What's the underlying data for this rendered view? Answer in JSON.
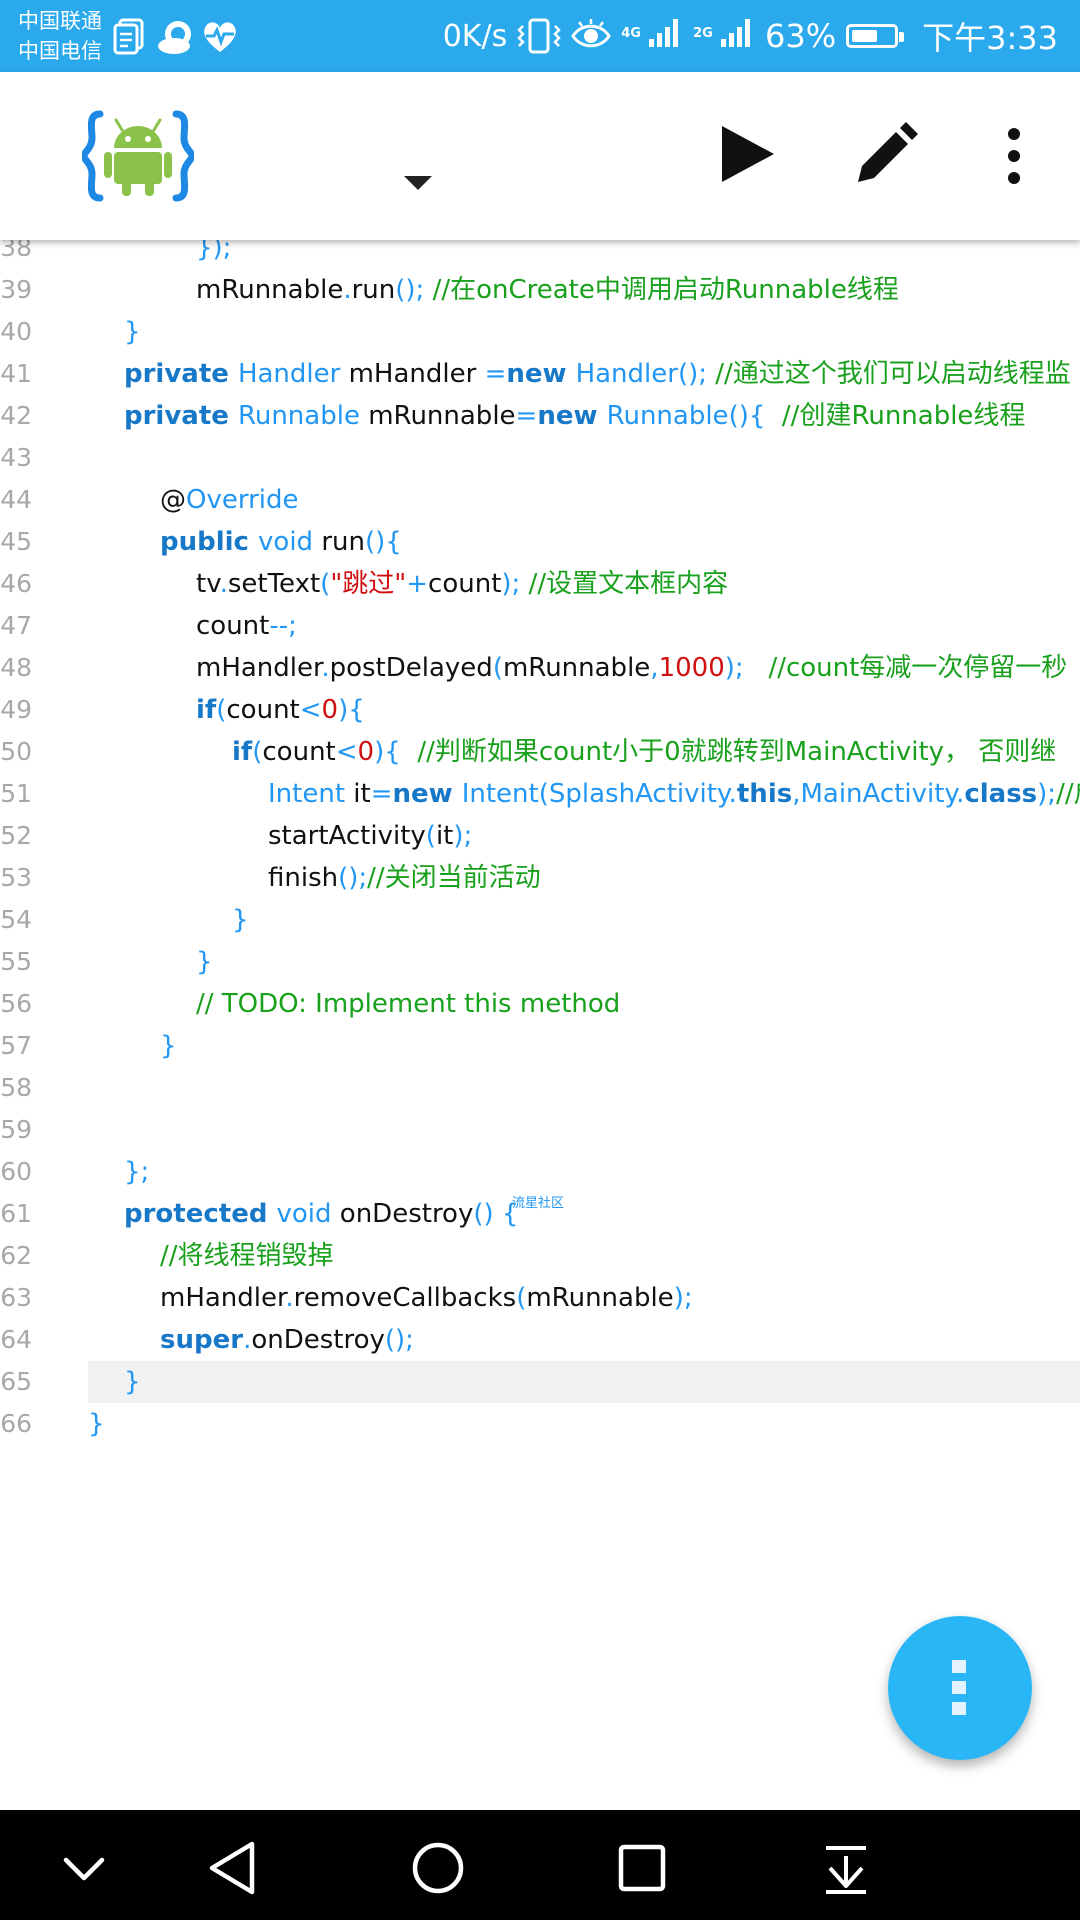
{
  "status_bar": {
    "carrier_1": "中国联通",
    "carrier_2": "中国电信",
    "net_speed": "0K/s",
    "net_type_1": "4G",
    "net_type_2": "2G",
    "battery_percent": "63%",
    "battery_level": 0.63,
    "time": "下午3:33",
    "icons": [
      "document-icon",
      "cloud-icon",
      "heart-pulse-icon",
      "vibrate-icon",
      "eye-icon",
      "signal-icon",
      "battery-icon"
    ]
  },
  "toolbar": {
    "logo_icon": "android-logo-icon",
    "dropdown_icon": "dropdown-triangle-icon",
    "run_icon": "play-icon",
    "edit_icon": "pencil-icon",
    "menu_icon": "more-vert-icon"
  },
  "colors": {
    "status_bar": "#2aa9ec",
    "keyword": "#1878c8",
    "type": "#2196f3",
    "string": "#d01010",
    "comment": "#19a01c",
    "line_number": "#a8a8a8",
    "fab": "#29b6f6"
  },
  "editor": {
    "current_line": "65",
    "watermark": "流星社区",
    "lines": [
      {
        "num": "38",
        "indent": 3,
        "tokens": [
          {
            "t": "punc",
            "v": "});"
          }
        ]
      },
      {
        "num": "39",
        "indent": 3,
        "tokens": [
          {
            "t": "plain",
            "v": "mRunnable"
          },
          {
            "t": "punc",
            "v": "."
          },
          {
            "t": "plain",
            "v": "run"
          },
          {
            "t": "punc",
            "v": "(); "
          },
          {
            "t": "cmt",
            "v": "//在onCreate中调用启动Runnable线程"
          }
        ]
      },
      {
        "num": "40",
        "indent": 1,
        "tokens": [
          {
            "t": "punc",
            "v": "}"
          }
        ]
      },
      {
        "num": "41",
        "indent": 1,
        "tokens": [
          {
            "t": "kw",
            "v": "private "
          },
          {
            "t": "type",
            "v": "Handler "
          },
          {
            "t": "plain",
            "v": "mHandler "
          },
          {
            "t": "punc",
            "v": "="
          },
          {
            "t": "kw",
            "v": "new "
          },
          {
            "t": "type",
            "v": "Handler"
          },
          {
            "t": "punc",
            "v": "(); "
          },
          {
            "t": "cmt",
            "v": "//通过这个我们可以启动线程监"
          }
        ]
      },
      {
        "num": "42",
        "indent": 1,
        "tokens": [
          {
            "t": "kw",
            "v": "private "
          },
          {
            "t": "type",
            "v": "Runnable "
          },
          {
            "t": "plain",
            "v": "mRunnable"
          },
          {
            "t": "punc",
            "v": "="
          },
          {
            "t": "kw",
            "v": "new "
          },
          {
            "t": "type",
            "v": "Runnable"
          },
          {
            "t": "punc",
            "v": "(){  "
          },
          {
            "t": "cmt",
            "v": "//创建Runnable线程"
          }
        ]
      },
      {
        "num": "43",
        "indent": 0,
        "tokens": []
      },
      {
        "num": "44",
        "indent": 2,
        "tokens": [
          {
            "t": "plain",
            "v": "@"
          },
          {
            "t": "type",
            "v": "Override"
          }
        ]
      },
      {
        "num": "45",
        "indent": 2,
        "tokens": [
          {
            "t": "kw",
            "v": "public "
          },
          {
            "t": "type",
            "v": "void "
          },
          {
            "t": "plain",
            "v": "run"
          },
          {
            "t": "punc",
            "v": "(){"
          }
        ]
      },
      {
        "num": "46",
        "indent": 3,
        "tokens": [
          {
            "t": "plain",
            "v": "tv"
          },
          {
            "t": "punc",
            "v": "."
          },
          {
            "t": "plain",
            "v": "setText"
          },
          {
            "t": "punc",
            "v": "("
          },
          {
            "t": "str",
            "v": "\"跳过\""
          },
          {
            "t": "punc",
            "v": "+"
          },
          {
            "t": "plain",
            "v": "count"
          },
          {
            "t": "punc",
            "v": "); "
          },
          {
            "t": "cmt",
            "v": "//设置文本框内容"
          }
        ]
      },
      {
        "num": "47",
        "indent": 3,
        "tokens": [
          {
            "t": "plain",
            "v": "count"
          },
          {
            "t": "punc",
            "v": "--;"
          }
        ]
      },
      {
        "num": "48",
        "indent": 3,
        "tokens": [
          {
            "t": "plain",
            "v": "mHandler"
          },
          {
            "t": "punc",
            "v": "."
          },
          {
            "t": "plain",
            "v": "postDelayed"
          },
          {
            "t": "punc",
            "v": "("
          },
          {
            "t": "plain",
            "v": "mRunnable"
          },
          {
            "t": "punc",
            "v": ","
          },
          {
            "t": "num",
            "v": "1000"
          },
          {
            "t": "punc",
            "v": ");   "
          },
          {
            "t": "cmt",
            "v": "//count每减一次停留一秒"
          }
        ]
      },
      {
        "num": "49",
        "indent": 3,
        "tokens": [
          {
            "t": "kw",
            "v": "if"
          },
          {
            "t": "punc",
            "v": "("
          },
          {
            "t": "plain",
            "v": "count"
          },
          {
            "t": "punc",
            "v": "<"
          },
          {
            "t": "num",
            "v": "0"
          },
          {
            "t": "punc",
            "v": "){"
          }
        ]
      },
      {
        "num": "50",
        "indent": 4,
        "tokens": [
          {
            "t": "kw",
            "v": "if"
          },
          {
            "t": "punc",
            "v": "("
          },
          {
            "t": "plain",
            "v": "count"
          },
          {
            "t": "punc",
            "v": "<"
          },
          {
            "t": "num",
            "v": "0"
          },
          {
            "t": "punc",
            "v": "){  "
          },
          {
            "t": "cmt",
            "v": "//判断如果count小于0就跳转到MainActivity， 否则继"
          }
        ]
      },
      {
        "num": "51",
        "indent": 5,
        "tokens": [
          {
            "t": "type",
            "v": "Intent "
          },
          {
            "t": "plain",
            "v": "it"
          },
          {
            "t": "punc",
            "v": "="
          },
          {
            "t": "kw",
            "v": "new "
          },
          {
            "t": "type",
            "v": "Intent"
          },
          {
            "t": "punc",
            "v": "("
          },
          {
            "t": "type",
            "v": "SplashActivity"
          },
          {
            "t": "punc",
            "v": "."
          },
          {
            "t": "kw",
            "v": "this"
          },
          {
            "t": "punc",
            "v": ","
          },
          {
            "t": "type",
            "v": "MainActivity"
          },
          {
            "t": "punc",
            "v": "."
          },
          {
            "t": "kw",
            "v": "class"
          },
          {
            "t": "punc",
            "v": ");"
          },
          {
            "t": "cmt",
            "v": "//启"
          }
        ]
      },
      {
        "num": "52",
        "indent": 5,
        "tokens": [
          {
            "t": "plain",
            "v": "startActivity"
          },
          {
            "t": "punc",
            "v": "("
          },
          {
            "t": "plain",
            "v": "it"
          },
          {
            "t": "punc",
            "v": ");"
          }
        ]
      },
      {
        "num": "53",
        "indent": 5,
        "tokens": [
          {
            "t": "plain",
            "v": "finish"
          },
          {
            "t": "punc",
            "v": "();"
          },
          {
            "t": "cmt",
            "v": "//关闭当前活动"
          }
        ]
      },
      {
        "num": "54",
        "indent": 4,
        "tokens": [
          {
            "t": "punc",
            "v": "}"
          }
        ]
      },
      {
        "num": "55",
        "indent": 3,
        "tokens": [
          {
            "t": "punc",
            "v": "}"
          }
        ]
      },
      {
        "num": "56",
        "indent": 3,
        "tokens": [
          {
            "t": "cmt",
            "v": "// TODO: Implement this method"
          }
        ]
      },
      {
        "num": "57",
        "indent": 2,
        "tokens": [
          {
            "t": "punc",
            "v": "}"
          }
        ]
      },
      {
        "num": "58",
        "indent": 0,
        "tokens": []
      },
      {
        "num": "59",
        "indent": 0,
        "tokens": []
      },
      {
        "num": "60",
        "indent": 1,
        "tokens": [
          {
            "t": "punc",
            "v": "};"
          }
        ]
      },
      {
        "num": "61",
        "indent": 1,
        "tokens": [
          {
            "t": "kw",
            "v": "protected "
          },
          {
            "t": "type",
            "v": "void "
          },
          {
            "t": "plain",
            "v": "onDestroy"
          },
          {
            "t": "punc",
            "v": "() {"
          }
        ]
      },
      {
        "num": "62",
        "indent": 2,
        "tokens": [
          {
            "t": "cmt",
            "v": "//将线程销毁掉"
          }
        ]
      },
      {
        "num": "63",
        "indent": 2,
        "tokens": [
          {
            "t": "plain",
            "v": "mHandler"
          },
          {
            "t": "punc",
            "v": "."
          },
          {
            "t": "plain",
            "v": "removeCallbacks"
          },
          {
            "t": "punc",
            "v": "("
          },
          {
            "t": "plain",
            "v": "mRunnable"
          },
          {
            "t": "punc",
            "v": ");"
          }
        ]
      },
      {
        "num": "64",
        "indent": 2,
        "tokens": [
          {
            "t": "kw",
            "v": "super"
          },
          {
            "t": "punc",
            "v": "."
          },
          {
            "t": "plain",
            "v": "onDestroy"
          },
          {
            "t": "punc",
            "v": "();"
          }
        ]
      },
      {
        "num": "65",
        "indent": 1,
        "tokens": [
          {
            "t": "punc",
            "v": "}"
          }
        ]
      },
      {
        "num": "66",
        "indent": 0,
        "tokens": [
          {
            "t": "punc",
            "v": "}"
          }
        ]
      }
    ]
  },
  "fab": {
    "icon": "more-vert-icon"
  },
  "nav_bar": {
    "icons": [
      "chevron-down-icon",
      "back-triangle-icon",
      "home-circle-icon",
      "recents-square-icon",
      "notification-pulldown-icon"
    ]
  }
}
